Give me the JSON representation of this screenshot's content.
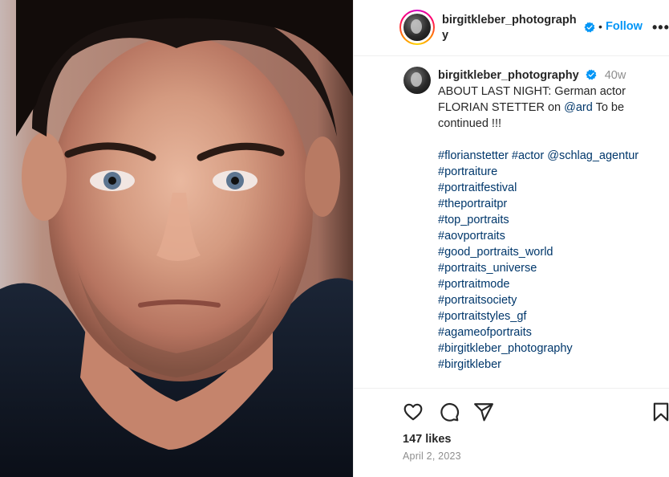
{
  "post": {
    "photo_alt": "Portrait of actor",
    "author": "birgitkleber_photography",
    "header_username": "birgitkleber_photograph y",
    "follow_label": "Follow",
    "separator": "•",
    "more_label": "•••",
    "time_ago": "40w",
    "caption_text": "ABOUT LAST NIGHT: German actor FLORIAN STETTER on ",
    "caption_mention": "@ard",
    "caption_tail": " To be continued !!!",
    "tags_line1": [
      "#florianstetter",
      "#actor",
      "@schlag_agentur"
    ],
    "tags": [
      "#portraiture",
      "#portraitfestival",
      "#theportraitpr",
      "#top_portraits",
      "#aovportraits",
      "#good_portraits_world",
      "#portraits_universe",
      "#portraitmode",
      "#portraitsociety",
      "#portraitstyles_gf",
      "#agameofportraits",
      "#birgitkleber_photography",
      "#birgitkleber"
    ],
    "likes": "147 likes",
    "date": "April 2, 2023"
  },
  "icons": {
    "like": "heart-icon",
    "comment": "comment-icon",
    "share": "paper-plane-icon",
    "save": "bookmark-icon",
    "verified": "verified-badge-icon"
  },
  "colors": {
    "accent": "#0095f6",
    "link": "#00376b",
    "muted": "#8e8e8e",
    "text": "#262626"
  }
}
